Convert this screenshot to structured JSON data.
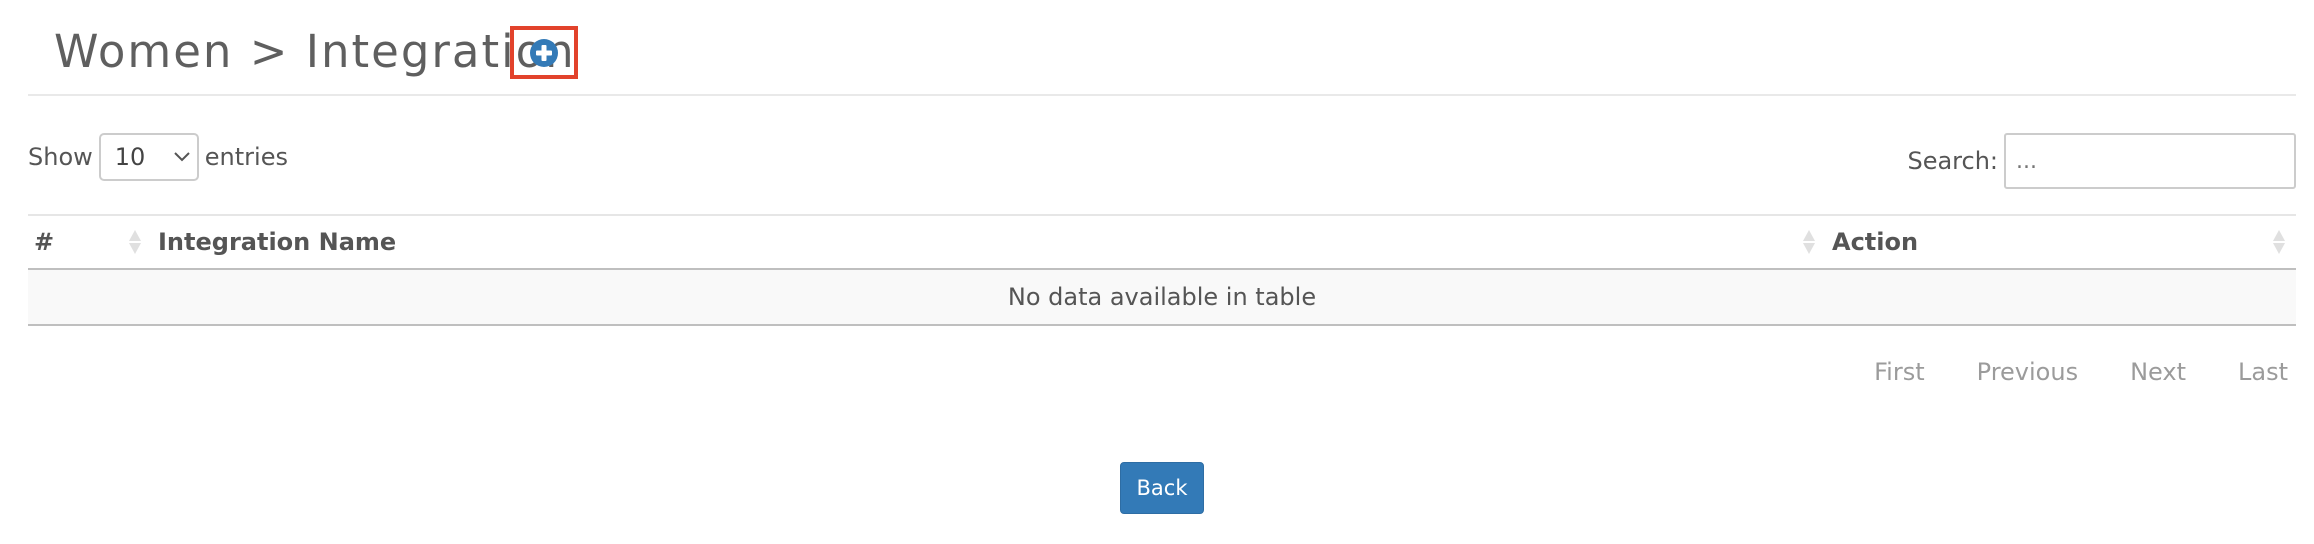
{
  "header": {
    "title": "Women > Integration",
    "add_icon": "plus-circle-icon",
    "accent_color": "#337ab7",
    "highlight_color": "#e2422b"
  },
  "length_control": {
    "prefix": "Show",
    "selected": "10",
    "suffix": "entries"
  },
  "search": {
    "label": "Search:",
    "placeholder": "..."
  },
  "table": {
    "columns": [
      {
        "label": "#"
      },
      {
        "label": "Integration Name"
      },
      {
        "label": "Action"
      }
    ],
    "empty_message": "No data available in table"
  },
  "pagination": {
    "first": "First",
    "previous": "Previous",
    "next": "Next",
    "last": "Last"
  },
  "footer": {
    "back_label": "Back"
  }
}
